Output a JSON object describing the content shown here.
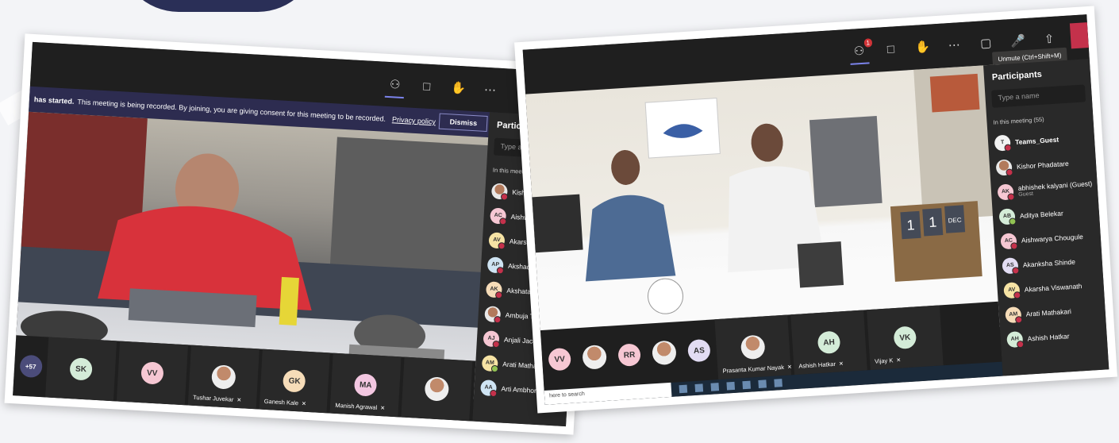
{
  "left_screen": {
    "toolbar": {
      "icons": [
        "people-icon",
        "chat-icon",
        "raise-hand-icon",
        "more-icon"
      ]
    },
    "banner": {
      "started": "has started.",
      "message": "This meeting is being recorded. By joining, you are giving consent for this meeting to be recorded.",
      "link": "Privacy policy",
      "dismiss": "Dismiss"
    },
    "panel": {
      "title": "Partic",
      "search_placeholder": "Type a",
      "section": "In this meet",
      "participants": [
        {
          "initials": "",
          "name": "Kish",
          "color": "#e6e6e6",
          "status": "red",
          "photo": true
        },
        {
          "initials": "AC",
          "name": "Aishw",
          "color": "#f6c7d3",
          "status": "red"
        },
        {
          "initials": "AV",
          "name": "Akarsh",
          "color": "#f6e3a4",
          "status": "red"
        },
        {
          "initials": "AP",
          "name": "Akshada",
          "color": "#cfe4f3",
          "status": "red"
        },
        {
          "initials": "AK",
          "name": "Akshata K",
          "color": "#f6dcb8",
          "status": "red"
        },
        {
          "initials": "",
          "name": "Ambuja T V",
          "color": "#e6e6e6",
          "status": "red",
          "photo": true
        },
        {
          "initials": "AJ",
          "name": "Anjali Jacob",
          "color": "#f6c7d3",
          "status": "red"
        },
        {
          "initials": "AM",
          "name": "Arati Mathaka",
          "color": "#f6e3a4",
          "status": "green"
        },
        {
          "initials": "AA",
          "name": "Arti Ambhore",
          "color": "#cfe4f3",
          "status": "red"
        }
      ]
    },
    "strip": {
      "count": "+57",
      "tiles": [
        {
          "initials": "SK",
          "color": "#d4ecd8",
          "name": ""
        },
        {
          "initials": "VV",
          "color": "#f6c7d3",
          "name": ""
        },
        {
          "initials": "",
          "color": "",
          "name": "Tushar Juvekar",
          "photo": true
        },
        {
          "initials": "GK",
          "color": "#f6dcb8",
          "name": "Ganesh Kale"
        },
        {
          "initials": "MA",
          "color": "#f3c7e1",
          "name": "Manish Agrawal"
        },
        {
          "initials": "",
          "color": "",
          "name": "",
          "photo": true
        }
      ]
    }
  },
  "right_screen": {
    "toolbar": {
      "people_count": "1",
      "icons": [
        "people-icon",
        "chat-icon",
        "raise-hand-icon",
        "more-icon",
        "camera-off-icon",
        "mic-off-icon",
        "share-icon"
      ]
    },
    "tooltip": "Unmute (Ctrl+Shift+M)",
    "video_signs": {
      "calendar": [
        "1",
        "1",
        "DEC"
      ]
    },
    "panel": {
      "title": "Participants",
      "search_placeholder": "Type a name",
      "section": "In this meeting (55)",
      "participants": [
        {
          "initials": "T",
          "name": "Teams_Guest",
          "color": "#f2f2f2",
          "status": "red",
          "bold": true
        },
        {
          "initials": "",
          "name": "Kishor Phadatare",
          "color": "#e6e6e6",
          "status": "red",
          "photo": true
        },
        {
          "initials": "AK",
          "name": "abhishek kalyani (Guest)",
          "sub": "Guest",
          "color": "#f6c7d3",
          "status": "red"
        },
        {
          "initials": "AB",
          "name": "Aditya Belekar",
          "color": "#d4ecd8",
          "status": "green"
        },
        {
          "initials": "AC",
          "name": "Aishwarya Chougule",
          "color": "#f6c7d3",
          "status": "red"
        },
        {
          "initials": "AS",
          "name": "Akanksha Shinde",
          "color": "#e2dcf3",
          "status": "red"
        },
        {
          "initials": "AV",
          "name": "Akarsha Viswanath",
          "color": "#f6e3a4",
          "status": "red"
        },
        {
          "initials": "AM",
          "name": "Arati Mathakari",
          "color": "#f6dcb8",
          "status": "red"
        },
        {
          "initials": "AH",
          "name": "Ashish Hatkar",
          "color": "#d4ecd8",
          "status": "red"
        }
      ]
    },
    "strip": {
      "tiles": [
        {
          "initials": "VV",
          "color": "#f6c7d3",
          "name": "",
          "plain": true
        },
        {
          "initials": "",
          "color": "",
          "name": "",
          "photo": true,
          "plain": true
        },
        {
          "initials": "RR",
          "color": "#f6c7d3",
          "name": "",
          "plain": true
        },
        {
          "initials": "",
          "color": "",
          "name": "",
          "photo": true,
          "plain": true
        },
        {
          "initials": "AS",
          "color": "#e2dcf3",
          "name": "",
          "plain": true
        },
        {
          "initials": "",
          "color": "",
          "name": "Prasanta Kumar Nayak",
          "photo": true
        },
        {
          "initials": "AH",
          "color": "#d4ecd8",
          "name": "Ashish Hatkar"
        },
        {
          "initials": "VK",
          "color": "#d4ecd8",
          "name": "Vijay K"
        }
      ]
    },
    "taskbar": {
      "search_text": "here to search"
    }
  }
}
